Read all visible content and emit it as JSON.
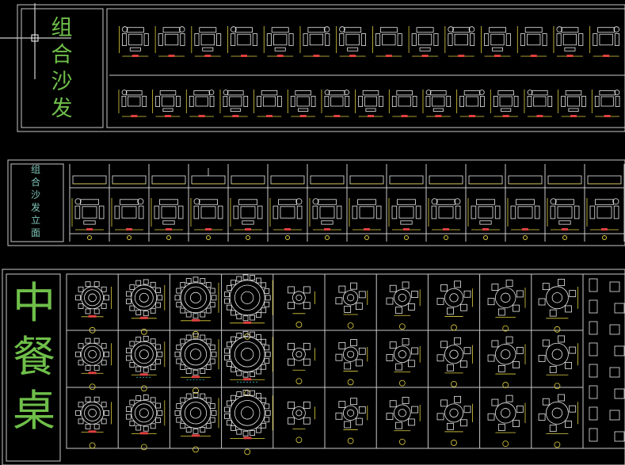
{
  "window": {
    "title": ""
  },
  "labels": {
    "sofa_set": [
      "组",
      "合",
      "沙",
      "发"
    ],
    "sofa_elevation": [
      "组",
      "合",
      "沙",
      "发",
      "立",
      "面"
    ],
    "dining_table": [
      "中",
      "餐",
      "桌"
    ]
  },
  "colors": {
    "background": "#000000",
    "frame": "#c8c8c8",
    "furniture": "#e8e8e8",
    "label_green": "#6fbf4a",
    "label_cyan": "#7fc6b8",
    "dimension_yellow": "#e0d040",
    "dimension_red": "#e04040",
    "accent_cyan": "#40d0e0",
    "cursor": "#ffffff"
  },
  "drawing": {
    "sofa_row1_count": 14,
    "sofa_row2_count": 15,
    "elevation_columns": 14,
    "round_table_rows": 3,
    "round_table_cols": 10
  }
}
